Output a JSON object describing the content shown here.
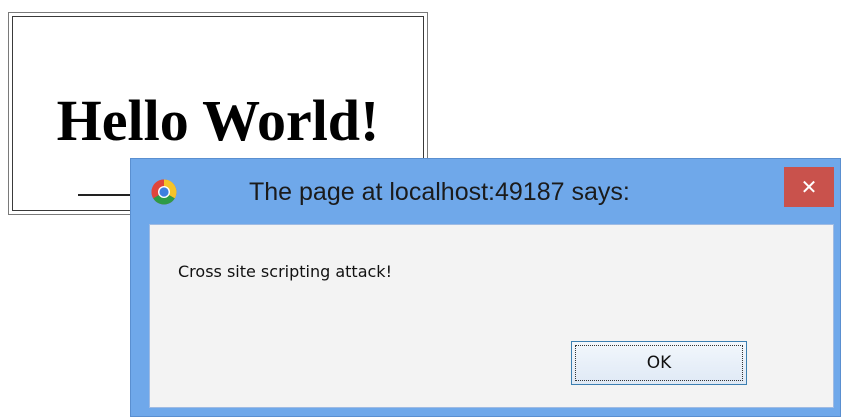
{
  "page": {
    "heading": "Hello World!"
  },
  "alert": {
    "title": "The page at localhost:49187 says:",
    "message": "Cross site scripting attack!",
    "ok_label": "OK",
    "close_glyph": "✕",
    "icon": "chrome-icon"
  },
  "colors": {
    "titlebar": "#6fa8ea",
    "close_button": "#c9524c",
    "dialog_body": "#f3f3f3",
    "ok_border": "#3c7fb1"
  }
}
